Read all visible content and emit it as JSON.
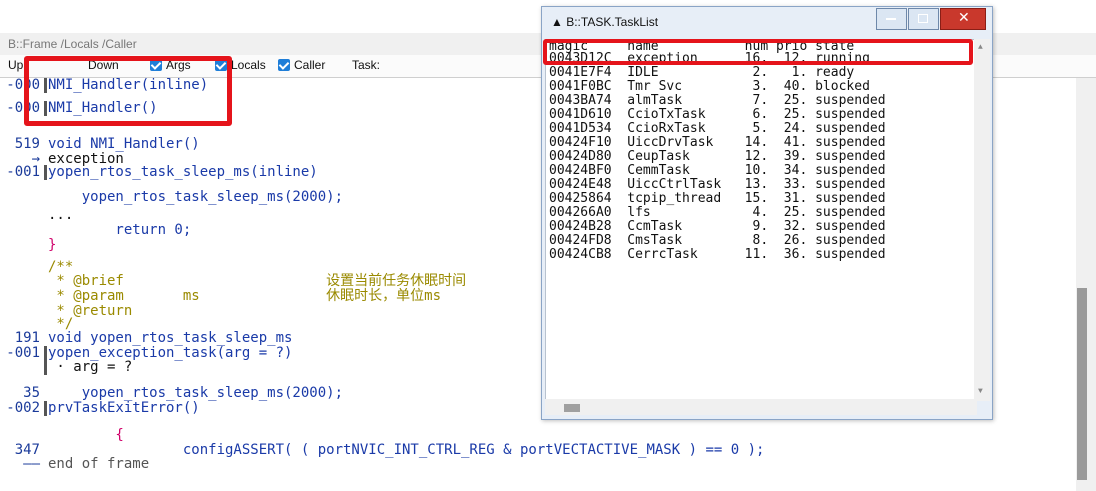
{
  "frame_window": {
    "title": "B::Frame /Locals /Caller",
    "toolbar": {
      "up_label": "Up",
      "down_label": "Down",
      "args_label": "Args",
      "locals_label": "Locals",
      "caller_label": "Caller",
      "task_label": "Task:"
    },
    "lines": [
      {
        "ln": "-000",
        "bar": true,
        "text": "NMI_Handler(inline)"
      },
      {
        "ln": "-000",
        "bar": true,
        "text": "NMI_Handler()"
      },
      {
        "ln": "519",
        "bar": false,
        "text": "void NMI_Handler()"
      },
      {
        "ln": "→",
        "bar": false,
        "text": "exception"
      },
      {
        "ln": "-001",
        "bar": true,
        "text": "yopen_rtos_task_sleep_ms(inline)"
      },
      {
        "ln": "",
        "bar": false,
        "text": "    yopen_rtos_task_sleep_ms(2000);"
      },
      {
        "ln": "",
        "bar": false,
        "text": "..."
      },
      {
        "ln": "",
        "bar": false,
        "text": "        return 0;"
      },
      {
        "ln": "",
        "bar": false,
        "text": "}"
      },
      {
        "ln": "",
        "bar": false,
        "text": "/**"
      },
      {
        "ln": "",
        "bar": false,
        "text": " * @brief                        设置当前任务休眠时间"
      },
      {
        "ln": "",
        "bar": false,
        "text": " * @param       ms               休眠时长，单位ms"
      },
      {
        "ln": "",
        "bar": false,
        "text": " * @return"
      },
      {
        "ln": "",
        "bar": false,
        "text": " */"
      },
      {
        "ln": "191",
        "bar": false,
        "text": "void yopen_rtos_task_sleep_ms"
      },
      {
        "ln": "-001",
        "bar": true,
        "text": "yopen_exception_task(arg = ?)"
      },
      {
        "ln": "",
        "bar": true,
        "text": " · arg = ?"
      },
      {
        "ln": "35",
        "bar": false,
        "text": "    yopen_rtos_task_sleep_ms(2000);"
      },
      {
        "ln": "-002",
        "bar": true,
        "text": "prvTaskExitError()"
      },
      {
        "ln": "",
        "bar": false,
        "text": "        {"
      },
      {
        "ln": "347",
        "bar": false,
        "text": "                configASSERT( ( portNVIC_INT_CTRL_REG & portVECTACTIVE_MASK ) == 0 );"
      },
      {
        "ln": "——",
        "bar": false,
        "text": "end of frame"
      }
    ]
  },
  "task_window": {
    "title": "B::TASK.TaskList",
    "header": {
      "magic": "magic",
      "name": "name",
      "num": "num",
      "prio": "prio",
      "state": "state"
    },
    "rows": [
      {
        "magic": "0043D12C",
        "name": "exception",
        "num": "16.",
        "prio": "12.",
        "state": "running"
      },
      {
        "magic": "0041E7F4",
        "name": "IDLE",
        "num": "2.",
        "prio": "1.",
        "state": "ready"
      },
      {
        "magic": "0041F0BC",
        "name": "Tmr Svc",
        "num": "3.",
        "prio": "40.",
        "state": "blocked"
      },
      {
        "magic": "0043BA74",
        "name": "almTask",
        "num": "7.",
        "prio": "25.",
        "state": "suspended"
      },
      {
        "magic": "0041D610",
        "name": "CcioTxTask",
        "num": "6.",
        "prio": "25.",
        "state": "suspended"
      },
      {
        "magic": "0041D534",
        "name": "CcioRxTask",
        "num": "5.",
        "prio": "24.",
        "state": "suspended"
      },
      {
        "magic": "00424F10",
        "name": "UiccDrvTask",
        "num": "14.",
        "prio": "41.",
        "state": "suspended"
      },
      {
        "magic": "00424D80",
        "name": "CeupTask",
        "num": "12.",
        "prio": "39.",
        "state": "suspended"
      },
      {
        "magic": "00424BF0",
        "name": "CemmTask",
        "num": "10.",
        "prio": "34.",
        "state": "suspended"
      },
      {
        "magic": "00424E48",
        "name": "UiccCtrlTask",
        "num": "13.",
        "prio": "33.",
        "state": "suspended"
      },
      {
        "magic": "00425864",
        "name": "tcpip_thread",
        "num": "15.",
        "prio": "31.",
        "state": "suspended"
      },
      {
        "magic": "004266A0",
        "name": "lfs",
        "num": "4.",
        "prio": "25.",
        "state": "suspended"
      },
      {
        "magic": "00424B28",
        "name": "CcmTask",
        "num": "9.",
        "prio": "32.",
        "state": "suspended"
      },
      {
        "magic": "00424FD8",
        "name": "CmsTask",
        "num": "8.",
        "prio": "26.",
        "state": "suspended"
      },
      {
        "magic": "00424CB8",
        "name": "CerrcTask",
        "num": "11.",
        "prio": "36.",
        "state": "suspended"
      }
    ]
  },
  "colors": {
    "highlight": "#e5141b",
    "line_number": "#1a3a9a",
    "comment": "#9a8a00",
    "number": "#b000b0",
    "checkbox": "#1f7ed8"
  }
}
